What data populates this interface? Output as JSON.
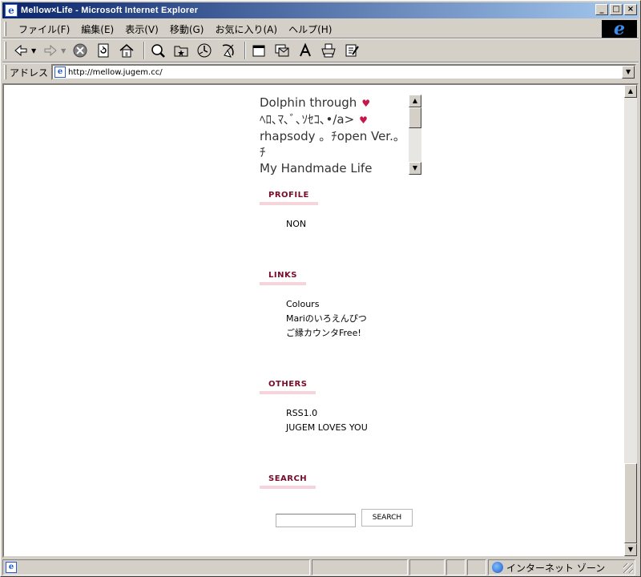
{
  "window": {
    "title": "Mellow×Life - Microsoft Internet Explorer",
    "minimize": "_",
    "maximize": "□",
    "close": "×"
  },
  "menu": {
    "items": [
      "ファイル(F)",
      "編集(E)",
      "表示(V)",
      "移動(G)",
      "お気に入り(A)",
      "ヘルプ(H)"
    ]
  },
  "address": {
    "label": "アドレス",
    "url": "http://mellow.jugem.cc/"
  },
  "page": {
    "scrollbox_lines": [
      {
        "text": "Dolphin through",
        "heart": true
      },
      {
        "text": "ﾍﾛ､ﾏ､ﾞ､ｿｾｺ､•/a>",
        "heart": true
      },
      {
        "text": "rhapsody 。ﾁopen Ver.。",
        "heart": false
      },
      {
        "text": "ﾁ",
        "heart": false
      },
      {
        "text": "My Handmade Life",
        "heart": false
      },
      {
        "text": "・・・",
        "heart": false
      }
    ],
    "heart_glyph": "♥",
    "sections": {
      "profile": {
        "title": "PROFILE",
        "items": [
          "NON"
        ]
      },
      "links": {
        "title": "LINKS",
        "items": [
          "Colours",
          "Mariのいろえんぴつ",
          "ご縁カウンタFree!"
        ]
      },
      "others": {
        "title": "OTHERS",
        "items": [
          "RSS1.0",
          "JUGEM LOVES YOU"
        ]
      },
      "search": {
        "title": "SEARCH",
        "button": "SEARCH",
        "value": ""
      }
    }
  },
  "status": {
    "zone": "インターネット ゾーン"
  },
  "colors": {
    "title_gradient_start": "#0a246a",
    "title_gradient_end": "#a6caf0",
    "section_title": "#7a0a2a",
    "section_underline": "#f5d4dc",
    "heart": "#c8154a"
  }
}
